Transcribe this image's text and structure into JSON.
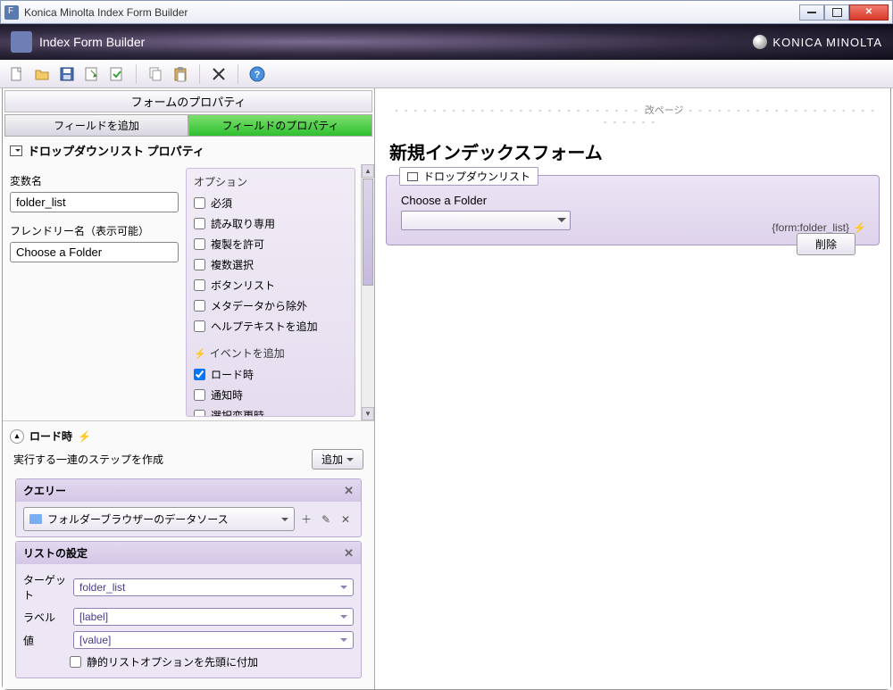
{
  "window": {
    "title": "Konica Minolta Index Form Builder"
  },
  "header": {
    "title": "Index Form Builder",
    "brand": "KONICA MINOLTA"
  },
  "left": {
    "section_header": "フォームのプロパティ",
    "tab_add_field": "フィールドを追加",
    "tab_field_props": "フィールドのプロパティ",
    "panel_title": "ドロップダウンリスト プロパティ",
    "var_name_label": "変数名",
    "var_name_value": "folder_list",
    "friendly_label": "フレンドリー名（表示可能）",
    "friendly_value": "Choose a Folder",
    "options_title": "オプション",
    "opts": {
      "required": "必須",
      "readonly": "読み取り専用",
      "allow_dup": "複製を許可",
      "multi": "複数選択",
      "btnlist": "ボタンリスト",
      "excl_meta": "メタデータから除外",
      "helptext": "ヘルプテキストを追加"
    },
    "events_title": "イベントを追加",
    "evts": {
      "onload": "ロード時",
      "onnotify": "通知時",
      "onchange": "選択変更時"
    },
    "onload_panel_title": "ロード時",
    "steps_label": "実行する一連のステップを作成",
    "add_btn": "追加",
    "query_card_title": "クエリー",
    "datasource_label": "フォルダーブラウザーのデータソース",
    "list_card_title": "リストの設定",
    "map": {
      "target_lbl": "ターゲット",
      "target_val": "folder_list",
      "label_lbl": "ラベル",
      "label_val": "[label]",
      "value_lbl": "値",
      "value_val": "[value]",
      "static_opt": "静的リストオプションを先頭に付加"
    }
  },
  "preview": {
    "page_break": "改ページ",
    "form_title": "新規インデックスフォーム",
    "field_legend": "ドロップダウンリスト",
    "field_label": "Choose a Folder",
    "form_ref": "{form:folder_list}",
    "delete_btn": "削除"
  }
}
